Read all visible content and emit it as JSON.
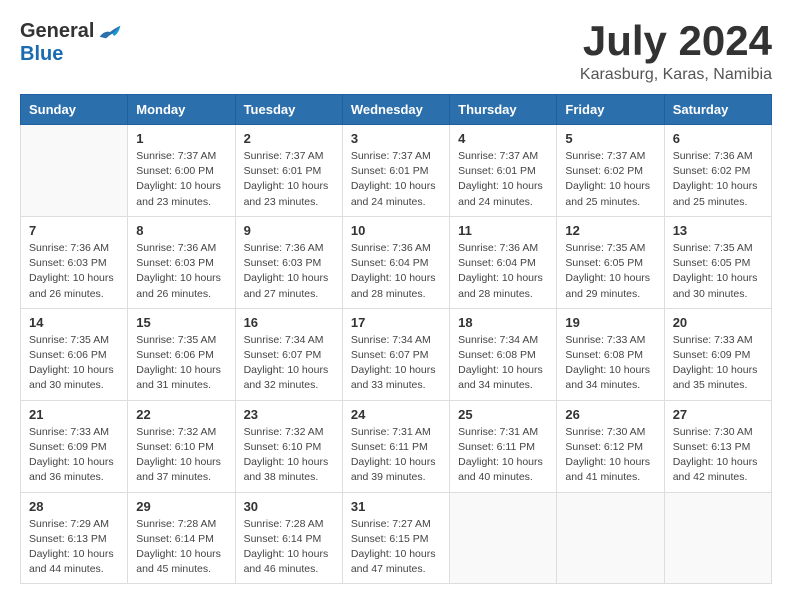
{
  "header": {
    "logo_general": "General",
    "logo_blue": "Blue",
    "month_title": "July 2024",
    "location": "Karasburg, Karas, Namibia"
  },
  "days_of_week": [
    "Sunday",
    "Monday",
    "Tuesday",
    "Wednesday",
    "Thursday",
    "Friday",
    "Saturday"
  ],
  "weeks": [
    [
      {
        "day": "",
        "info": ""
      },
      {
        "day": "1",
        "info": "Sunrise: 7:37 AM\nSunset: 6:00 PM\nDaylight: 10 hours\nand 23 minutes."
      },
      {
        "day": "2",
        "info": "Sunrise: 7:37 AM\nSunset: 6:01 PM\nDaylight: 10 hours\nand 23 minutes."
      },
      {
        "day": "3",
        "info": "Sunrise: 7:37 AM\nSunset: 6:01 PM\nDaylight: 10 hours\nand 24 minutes."
      },
      {
        "day": "4",
        "info": "Sunrise: 7:37 AM\nSunset: 6:01 PM\nDaylight: 10 hours\nand 24 minutes."
      },
      {
        "day": "5",
        "info": "Sunrise: 7:37 AM\nSunset: 6:02 PM\nDaylight: 10 hours\nand 25 minutes."
      },
      {
        "day": "6",
        "info": "Sunrise: 7:36 AM\nSunset: 6:02 PM\nDaylight: 10 hours\nand 25 minutes."
      }
    ],
    [
      {
        "day": "7",
        "info": "Sunrise: 7:36 AM\nSunset: 6:03 PM\nDaylight: 10 hours\nand 26 minutes."
      },
      {
        "day": "8",
        "info": "Sunrise: 7:36 AM\nSunset: 6:03 PM\nDaylight: 10 hours\nand 26 minutes."
      },
      {
        "day": "9",
        "info": "Sunrise: 7:36 AM\nSunset: 6:03 PM\nDaylight: 10 hours\nand 27 minutes."
      },
      {
        "day": "10",
        "info": "Sunrise: 7:36 AM\nSunset: 6:04 PM\nDaylight: 10 hours\nand 28 minutes."
      },
      {
        "day": "11",
        "info": "Sunrise: 7:36 AM\nSunset: 6:04 PM\nDaylight: 10 hours\nand 28 minutes."
      },
      {
        "day": "12",
        "info": "Sunrise: 7:35 AM\nSunset: 6:05 PM\nDaylight: 10 hours\nand 29 minutes."
      },
      {
        "day": "13",
        "info": "Sunrise: 7:35 AM\nSunset: 6:05 PM\nDaylight: 10 hours\nand 30 minutes."
      }
    ],
    [
      {
        "day": "14",
        "info": "Sunrise: 7:35 AM\nSunset: 6:06 PM\nDaylight: 10 hours\nand 30 minutes."
      },
      {
        "day": "15",
        "info": "Sunrise: 7:35 AM\nSunset: 6:06 PM\nDaylight: 10 hours\nand 31 minutes."
      },
      {
        "day": "16",
        "info": "Sunrise: 7:34 AM\nSunset: 6:07 PM\nDaylight: 10 hours\nand 32 minutes."
      },
      {
        "day": "17",
        "info": "Sunrise: 7:34 AM\nSunset: 6:07 PM\nDaylight: 10 hours\nand 33 minutes."
      },
      {
        "day": "18",
        "info": "Sunrise: 7:34 AM\nSunset: 6:08 PM\nDaylight: 10 hours\nand 34 minutes."
      },
      {
        "day": "19",
        "info": "Sunrise: 7:33 AM\nSunset: 6:08 PM\nDaylight: 10 hours\nand 34 minutes."
      },
      {
        "day": "20",
        "info": "Sunrise: 7:33 AM\nSunset: 6:09 PM\nDaylight: 10 hours\nand 35 minutes."
      }
    ],
    [
      {
        "day": "21",
        "info": "Sunrise: 7:33 AM\nSunset: 6:09 PM\nDaylight: 10 hours\nand 36 minutes."
      },
      {
        "day": "22",
        "info": "Sunrise: 7:32 AM\nSunset: 6:10 PM\nDaylight: 10 hours\nand 37 minutes."
      },
      {
        "day": "23",
        "info": "Sunrise: 7:32 AM\nSunset: 6:10 PM\nDaylight: 10 hours\nand 38 minutes."
      },
      {
        "day": "24",
        "info": "Sunrise: 7:31 AM\nSunset: 6:11 PM\nDaylight: 10 hours\nand 39 minutes."
      },
      {
        "day": "25",
        "info": "Sunrise: 7:31 AM\nSunset: 6:11 PM\nDaylight: 10 hours\nand 40 minutes."
      },
      {
        "day": "26",
        "info": "Sunrise: 7:30 AM\nSunset: 6:12 PM\nDaylight: 10 hours\nand 41 minutes."
      },
      {
        "day": "27",
        "info": "Sunrise: 7:30 AM\nSunset: 6:13 PM\nDaylight: 10 hours\nand 42 minutes."
      }
    ],
    [
      {
        "day": "28",
        "info": "Sunrise: 7:29 AM\nSunset: 6:13 PM\nDaylight: 10 hours\nand 44 minutes."
      },
      {
        "day": "29",
        "info": "Sunrise: 7:28 AM\nSunset: 6:14 PM\nDaylight: 10 hours\nand 45 minutes."
      },
      {
        "day": "30",
        "info": "Sunrise: 7:28 AM\nSunset: 6:14 PM\nDaylight: 10 hours\nand 46 minutes."
      },
      {
        "day": "31",
        "info": "Sunrise: 7:27 AM\nSunset: 6:15 PM\nDaylight: 10 hours\nand 47 minutes."
      },
      {
        "day": "",
        "info": ""
      },
      {
        "day": "",
        "info": ""
      },
      {
        "day": "",
        "info": ""
      }
    ]
  ]
}
